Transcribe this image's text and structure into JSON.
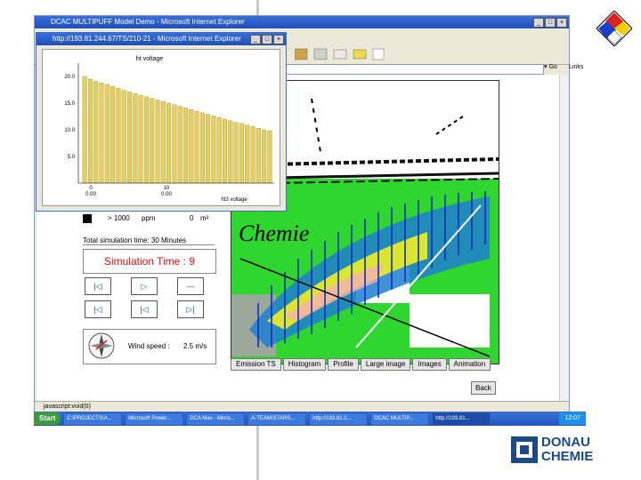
{
  "outer_window": {
    "title": "DCAC MULTIPUFF Model Demo - Microsoft Internet Explorer"
  },
  "popup_window": {
    "title": "http://193.81.244.67/TS/210-21 - Microsoft Internet Explorer"
  },
  "browser": {
    "go_label": "Go",
    "links_label": "Links",
    "status_text": "javascript:void(0)"
  },
  "panel": {
    "concentration_value": "> 1000",
    "concentration_unit": "ppm",
    "area_value": "0",
    "area_unit": "m²",
    "total_sim_time": "Total simulation time: 30 Minutes",
    "simulation_time": "Simulation Time : 9",
    "buttons": [
      "|◁",
      "▷",
      "—",
      "|◁",
      "|◁",
      "▷|"
    ],
    "wind_label": "Wind speed :",
    "wind_value": "2.5 m/s"
  },
  "map_buttons": [
    "Emission TS",
    "Histogram",
    "Profile",
    "Large image",
    "Images",
    "Animation"
  ],
  "back_label": "Back",
  "taskbar": {
    "start": "Start",
    "items": [
      "C:\\PROJECTS\\A...",
      "Microsoft Power...",
      "DCA Max - Micro...",
      "A-TEAM\\STARS...",
      "http://193.81.2...",
      "DCAC MULTIP...",
      "http://193.81..."
    ],
    "clock": "12:07"
  },
  "logo": {
    "line1": "DONAU",
    "line2": "CHEMIE"
  },
  "map_labels": {
    "chemie": "Chemie"
  },
  "chart_data": {
    "type": "bar",
    "title": "ht voltage",
    "xlabel": "ht3 voltage",
    "ylabel": "",
    "y_tick_labels": [
      "5.0",
      "10.0",
      "15.0",
      "20.0"
    ],
    "x_tick_labels": [
      "0\n0.00",
      "10\n0.00"
    ],
    "ylim": [
      0,
      22
    ],
    "values": [
      20,
      19.5,
      19.1,
      18.8,
      18.5,
      18.1,
      17.8,
      17.4,
      17.1,
      16.8,
      16.5,
      16.2,
      15.9,
      15.6,
      15.3,
      15.0,
      14.7,
      14.4,
      14.1,
      13.8,
      13.5,
      13.2,
      12.9,
      12.6,
      12.3,
      12.0,
      11.7,
      11.4,
      11.2,
      10.9,
      10.6,
      10.3,
      10.0,
      9.8
    ]
  }
}
